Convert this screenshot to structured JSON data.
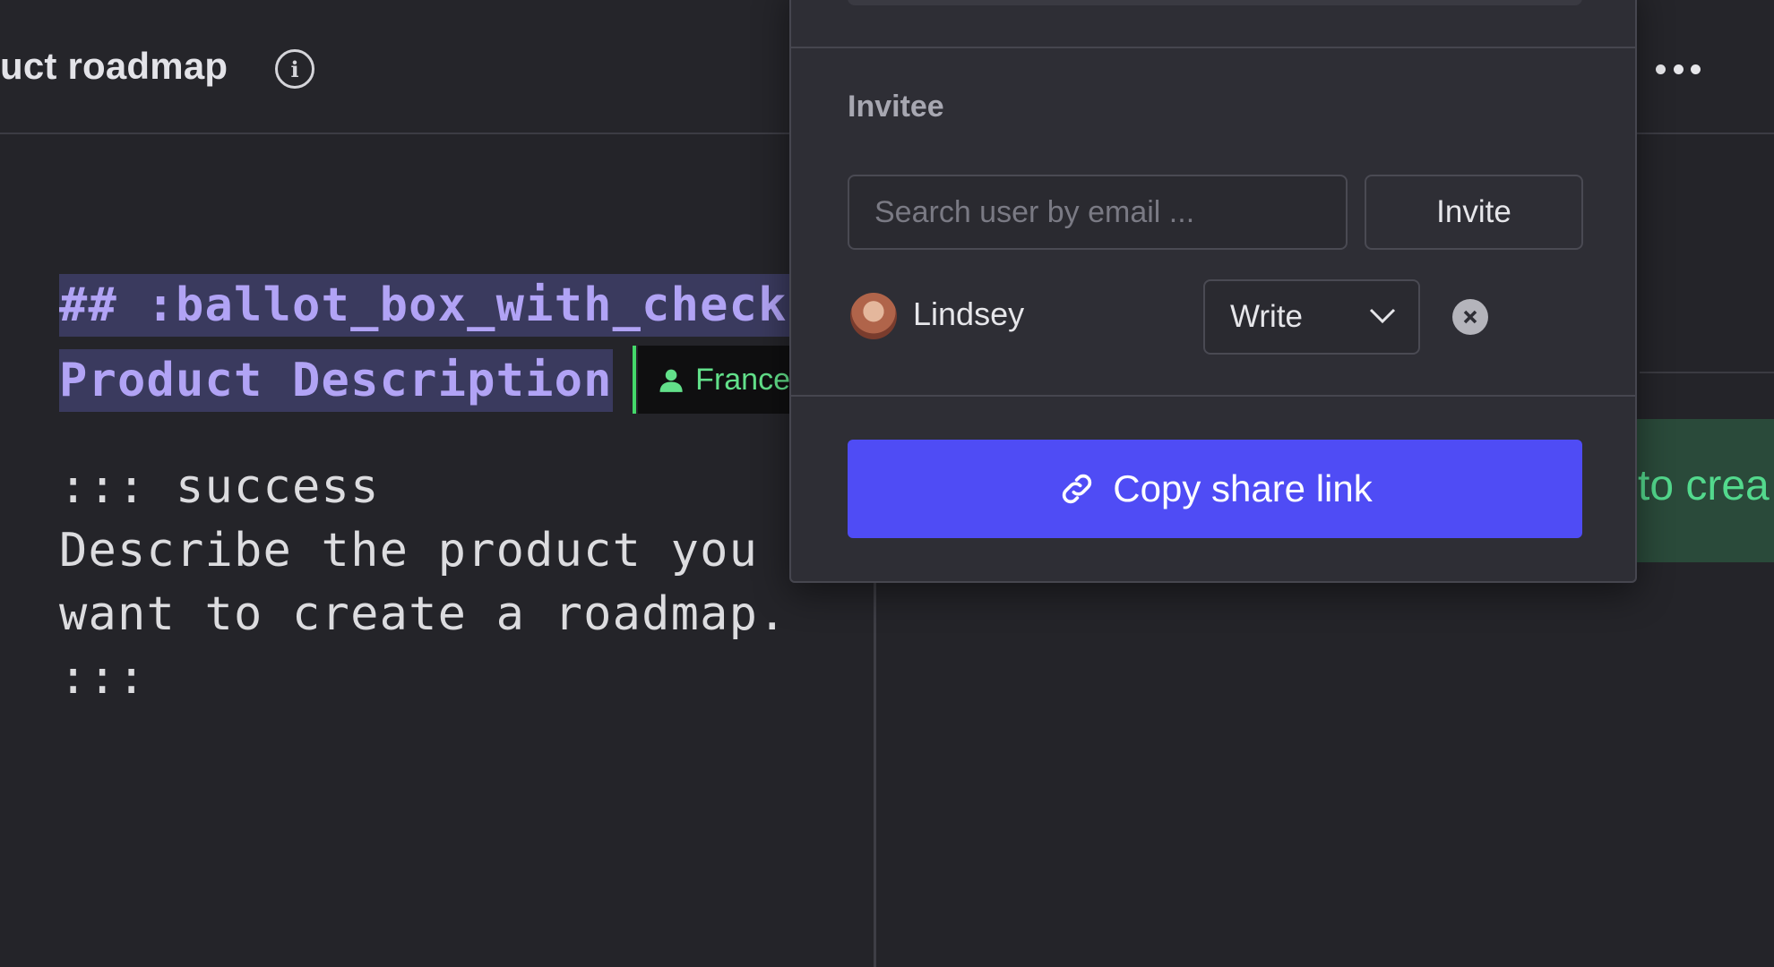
{
  "header": {
    "doc_title": "uct roadmap",
    "info_icon": "info-icon",
    "more_icon": "more-horizontal-icon"
  },
  "editor": {
    "heading_line_1": "## :ballot_box_with_check",
    "heading_line_2": "Product Description",
    "collaborator_name": "France",
    "lines": [
      "::: success",
      "Describe the product you",
      "want to create a roadmap.",
      ":::"
    ]
  },
  "preview": {
    "callout_text": "to crea",
    "callout_color": "#53d98d"
  },
  "share_popover": {
    "invitee_label": "Invitee",
    "search_placeholder": "Search user by email ...",
    "invite_label": "Invite",
    "invitees": [
      {
        "name": "Lindsey",
        "permission": "Write"
      }
    ],
    "copy_link_label": "Copy share link",
    "accent_color": "#4f4cf5"
  }
}
